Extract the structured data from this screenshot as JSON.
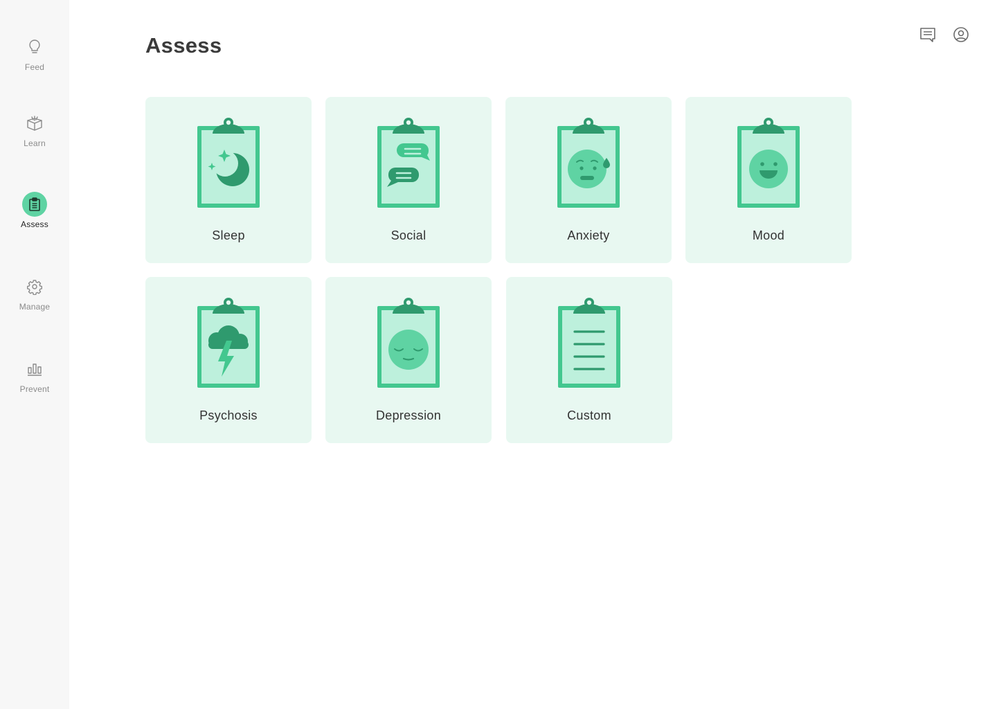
{
  "sidebar": {
    "items": [
      {
        "label": "Feed",
        "icon": "lightbulb-icon",
        "active": false
      },
      {
        "label": "Learn",
        "icon": "book-icon",
        "active": false
      },
      {
        "label": "Assess",
        "icon": "clipboard-icon",
        "active": true
      },
      {
        "label": "Manage",
        "icon": "gear-icon",
        "active": false
      },
      {
        "label": "Prevent",
        "icon": "bar-chart-icon",
        "active": false
      }
    ]
  },
  "header": {
    "title": "Assess",
    "actions": [
      {
        "icon": "message-icon"
      },
      {
        "icon": "user-profile-icon"
      }
    ]
  },
  "assessments": [
    {
      "label": "Sleep",
      "icon": "moon-stars-icon"
    },
    {
      "label": "Social",
      "icon": "speech-bubbles-icon"
    },
    {
      "label": "Anxiety",
      "icon": "anxious-face-icon"
    },
    {
      "label": "Mood",
      "icon": "happy-face-icon"
    },
    {
      "label": "Psychosis",
      "icon": "storm-cloud-icon"
    },
    {
      "label": "Depression",
      "icon": "sad-face-icon"
    },
    {
      "label": "Custom",
      "icon": "lines-icon"
    }
  ],
  "colors": {
    "accent": "#5fd3a3",
    "clipboard_frame": "#43c78f",
    "clipboard_dark": "#2f9a6e",
    "clipboard_paper": "#bdf0dc",
    "card_bg": "#e8f8f1",
    "sidebar_bg": "#f7f7f7"
  }
}
